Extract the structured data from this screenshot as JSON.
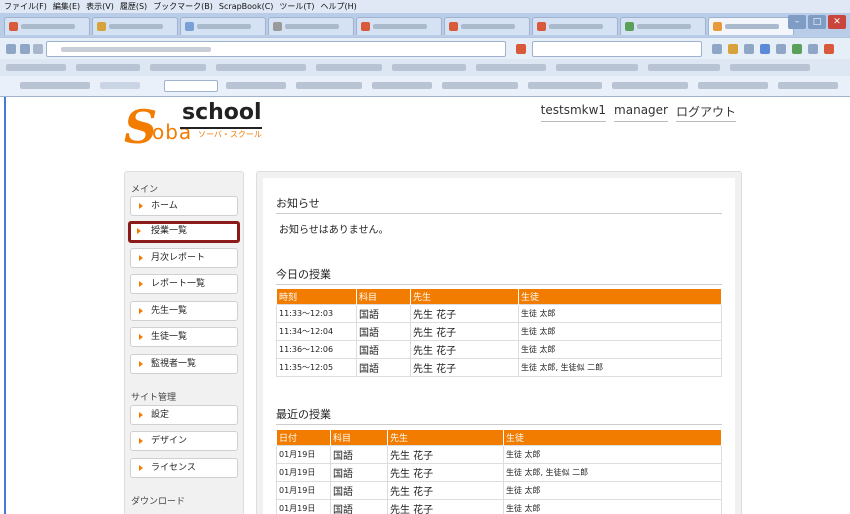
{
  "browser": {
    "menu": [
      "ファイル(F)",
      "編集(E)",
      "表示(V)",
      "履歴(S)",
      "ブックマーク(B)",
      "ScrapBook(C)",
      "ツール(T)",
      "ヘルプ(H)"
    ]
  },
  "header": {
    "logo_letter": "S",
    "logo_oba": "oba",
    "logo_school": "school",
    "logo_kana": "ソーバ・スクール",
    "user": "testsmkw1",
    "role": "manager",
    "logout": "ログアウト"
  },
  "sidebar": {
    "main_heading": "メイン",
    "main_items": [
      "ホーム",
      "授業一覧",
      "月次レポート",
      "レポート一覧",
      "先生一覧",
      "生徒一覧",
      "監視者一覧"
    ],
    "site_heading": "サイト管理",
    "site_items": [
      "設定",
      "デザイン",
      "ライセンス"
    ],
    "download_heading": "ダウンロード"
  },
  "notices": {
    "title": "お知らせ",
    "empty_text": "お知らせはありません。"
  },
  "today": {
    "title": "今日の授業",
    "headers": [
      "時刻",
      "科目",
      "先生",
      "生徒"
    ],
    "rows": [
      [
        "11:33〜12:03",
        "国語",
        "先生 花子",
        "生徒 太郎"
      ],
      [
        "11:34〜12:04",
        "国語",
        "先生 花子",
        "生徒 太郎"
      ],
      [
        "11:36〜12:06",
        "国語",
        "先生 花子",
        "生徒 太郎"
      ],
      [
        "11:35〜12:05",
        "国語",
        "先生 花子",
        "生徒 太郎, 生徒似 二郎"
      ]
    ]
  },
  "recent": {
    "title": "最近の授業",
    "headers": [
      "日付",
      "科目",
      "先生",
      "生徒"
    ],
    "rows": [
      [
        "01月19日",
        "国語",
        "先生 花子",
        "生徒 太郎"
      ],
      [
        "01月19日",
        "国語",
        "先生 花子",
        "生徒 太郎, 生徒似 二郎"
      ],
      [
        "01月19日",
        "国語",
        "先生 花子",
        "生徒 太郎"
      ],
      [
        "01月19日",
        "国語",
        "先生 花子",
        "生徒 太郎"
      ]
    ]
  },
  "colors": {
    "accent": "#f27c00",
    "selected_border": "#8b1a1a"
  }
}
